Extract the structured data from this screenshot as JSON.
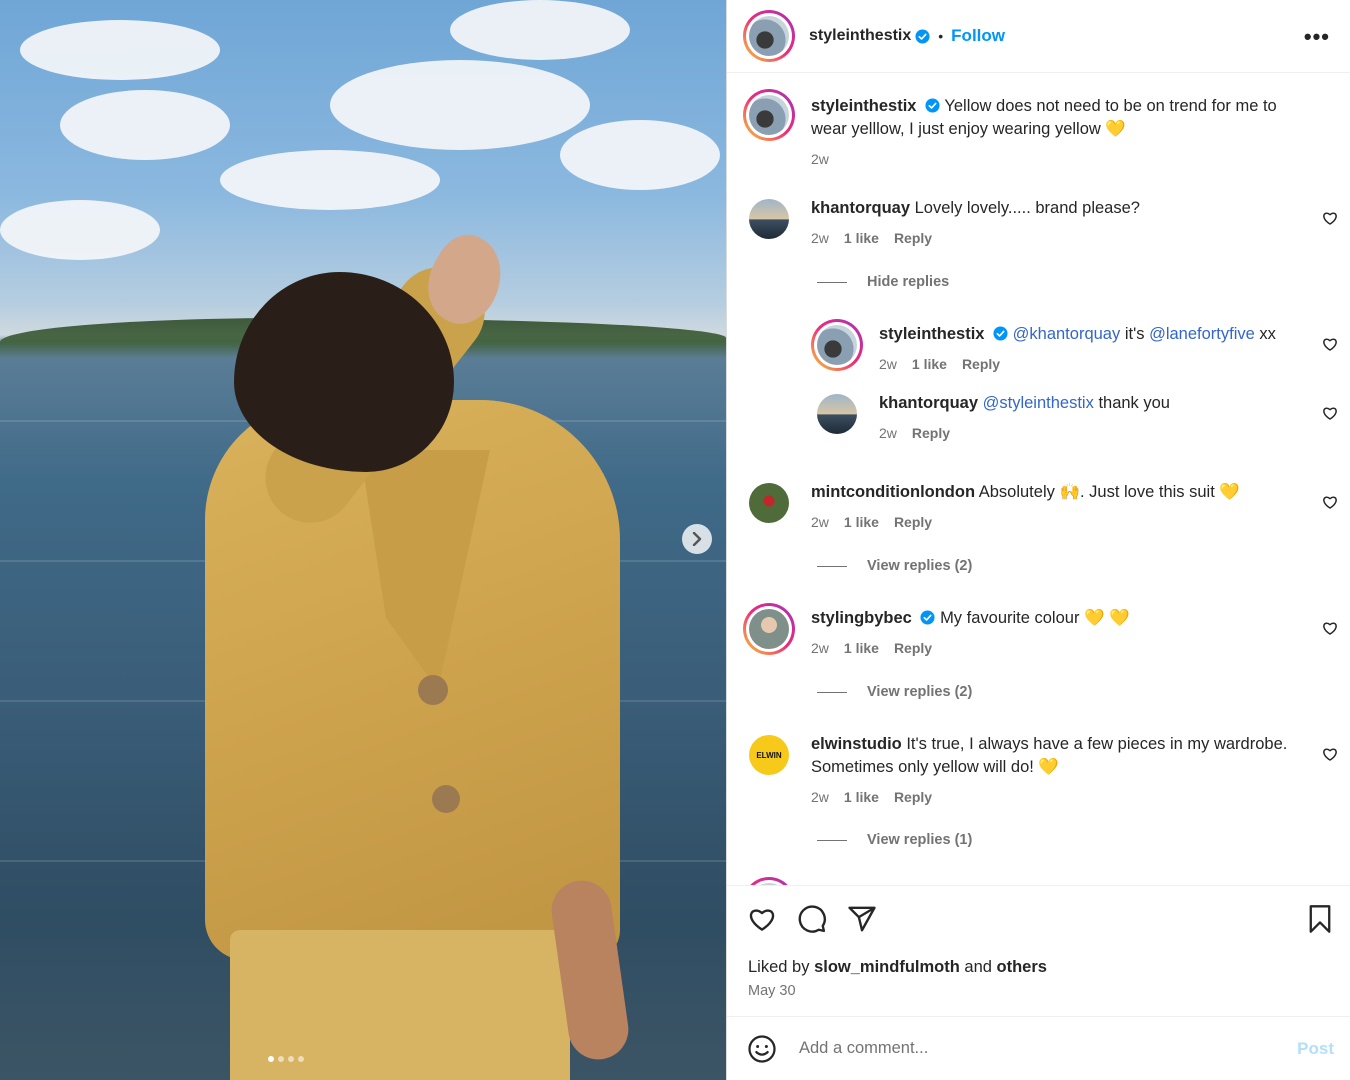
{
  "post": {
    "author": "styleinthestix",
    "follow_label": "Follow",
    "bullet": "•",
    "more_label": "•••",
    "carousel": {
      "current": 1,
      "total": 4
    }
  },
  "caption": {
    "username": "styleinthestix",
    "text": "Yellow does not need to be on trend for me to wear yelllow, I just enjoy wearing yellow 💛",
    "time": "2w"
  },
  "comments": [
    {
      "username": "khantorquay",
      "text": "Lovely lovely..... brand please?",
      "time": "2w",
      "likes": "1 like",
      "reply": "Reply"
    },
    {
      "username": "styleinthestix",
      "mention1": "@khantorquay",
      "mid": "it's",
      "mention2": "@lanefortyfive",
      "tail": "xx",
      "time": "2w",
      "likes": "1 like",
      "reply": "Reply"
    },
    {
      "username": "khantorquay",
      "mention1": "@styleinthestix",
      "tail": "thank you",
      "time": "2w",
      "reply": "Reply"
    },
    {
      "username": "mintconditionlondon",
      "text": "Absolutely 🙌. Just love this suit 💛",
      "time": "2w",
      "likes": "1 like",
      "reply": "Reply"
    },
    {
      "username": "stylingbybec",
      "text": "My favourite colour 💛 💛",
      "time": "2w",
      "likes": "1 like",
      "reply": "Reply"
    },
    {
      "username": "elwinstudio",
      "text": "It's true, I always have a few pieces in my wardrobe. Sometimes only yellow will do! 💛",
      "time": "2w",
      "likes": "1 like",
      "reply": "Reply",
      "avatar_text": "ELWIN"
    }
  ],
  "thread_links": {
    "hide_replies": "Hide replies",
    "view_replies_mint": "View replies (2)",
    "view_replies_bec": "View replies (2)",
    "view_replies_elwin": "View replies (1)"
  },
  "likes": {
    "prefix": "Liked by",
    "user": "slow_mindfulmoth",
    "and": "and",
    "others": "others"
  },
  "date": "May 30",
  "comment_box": {
    "placeholder": "Add a comment...",
    "post_label": "Post"
  },
  "colors": {
    "accent_blue": "#0095f6",
    "mention_blue": "#3366cc",
    "muted": "#737373",
    "post_disabled": "#b2dffc"
  }
}
